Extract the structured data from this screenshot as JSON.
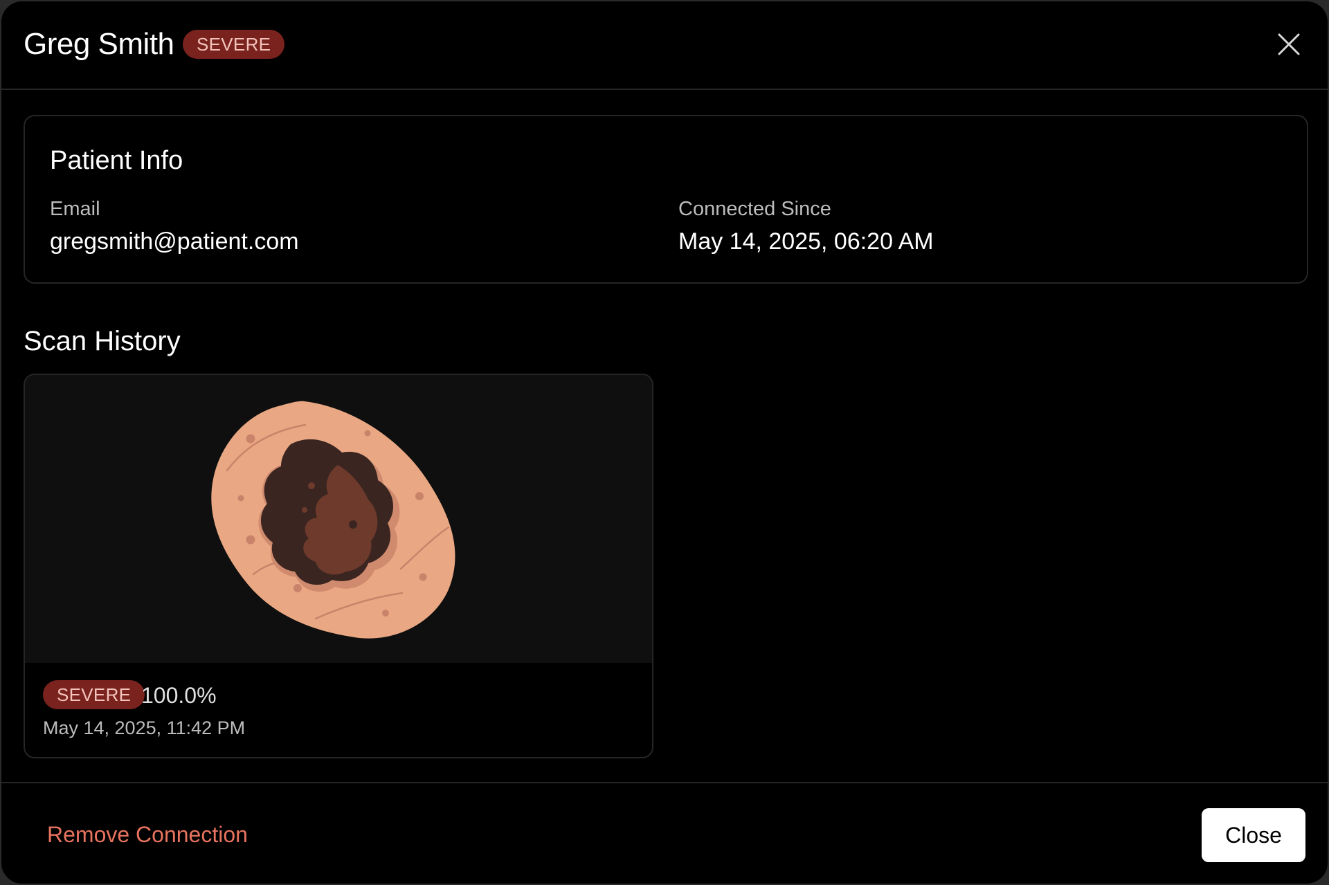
{
  "header": {
    "patient_name": "Greg Smith",
    "severity_badge": "SEVERE",
    "close_icon": "close-icon"
  },
  "patient_info": {
    "title": "Patient Info",
    "email_label": "Email",
    "email_value": "gregsmith@patient.com",
    "connected_label": "Connected Since",
    "connected_value": "May 14, 2025, 06:20 AM"
  },
  "scan_history": {
    "title": "Scan History",
    "scans": [
      {
        "severity": "SEVERE",
        "score": "100.0%",
        "date": "May 14, 2025, 11:42 PM",
        "image_icon": "skin-lesion-illustration"
      }
    ]
  },
  "footer": {
    "remove_label": "Remove Connection",
    "close_label": "Close"
  },
  "colors": {
    "background": "#000000",
    "badge_bg": "#7a231e",
    "badge_text": "#f3c3bc",
    "danger_link": "#e8735f",
    "border": "#262626"
  }
}
